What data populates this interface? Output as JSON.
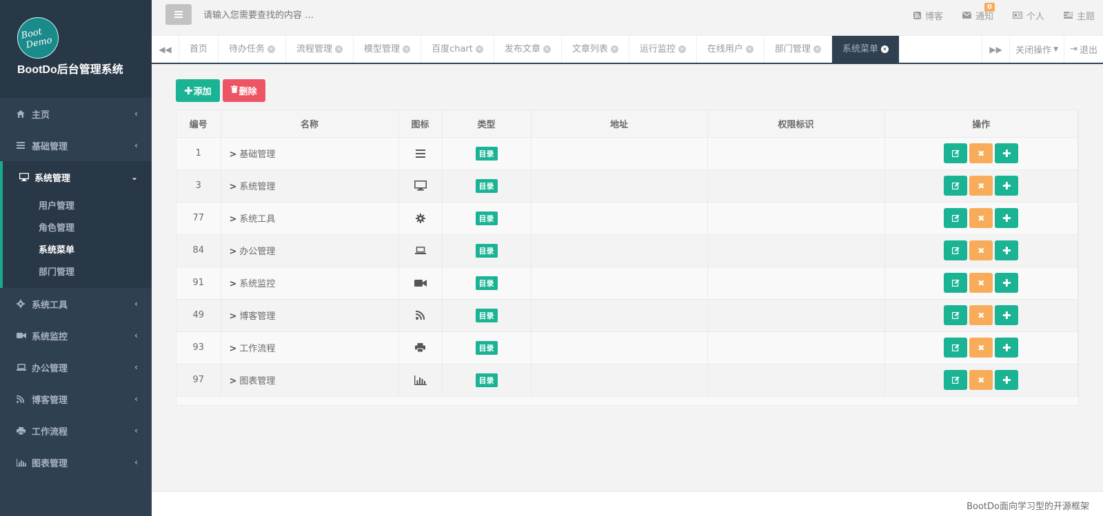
{
  "app": {
    "logo_line1": "Boot",
    "logo_line2": "Demo",
    "name": "BootDo后台管理系统"
  },
  "sidebar": {
    "items": [
      {
        "label": "主页",
        "icon": "home-icon"
      },
      {
        "label": "基础管理",
        "icon": "bars-icon"
      },
      {
        "label": "系统管理",
        "icon": "desktop-icon",
        "expanded": true
      },
      {
        "label": "系统工具",
        "icon": "gear-icon"
      },
      {
        "label": "系统监控",
        "icon": "video-icon"
      },
      {
        "label": "办公管理",
        "icon": "laptop-icon"
      },
      {
        "label": "博客管理",
        "icon": "rss-icon"
      },
      {
        "label": "工作流程",
        "icon": "print-icon"
      },
      {
        "label": "图表管理",
        "icon": "bar-chart-icon"
      }
    ],
    "sub_items": [
      "用户管理",
      "角色管理",
      "系统菜单",
      "部门管理"
    ],
    "active_sub": "系统菜单"
  },
  "topbar": {
    "search_placeholder": "请输入您需要查找的内容 …",
    "links": {
      "blog": "博客",
      "notify": "通知",
      "notify_count": "0",
      "personal": "个人",
      "theme": "主题"
    }
  },
  "tabs": {
    "items": [
      "首页",
      "待办任务",
      "流程管理",
      "模型管理",
      "百度chart",
      "发布文章",
      "文章列表",
      "运行监控",
      "在线用户",
      "部门管理",
      "系统菜单"
    ],
    "active": "系统菜单",
    "close_ops": "关闭操作",
    "logout": "退出"
  },
  "toolbar": {
    "add_label": "添加",
    "delete_label": "删除"
  },
  "table": {
    "headers": [
      "编号",
      "名称",
      "图标",
      "类型",
      "地址",
      "权限标识",
      "操作"
    ],
    "rows": [
      {
        "id": "1",
        "name": "基础管理",
        "icon": "bars-icon",
        "type": "目录",
        "url": "",
        "perms": ""
      },
      {
        "id": "3",
        "name": "系统管理",
        "icon": "desktop-icon",
        "type": "目录",
        "url": "",
        "perms": ""
      },
      {
        "id": "77",
        "name": "系统工具",
        "icon": "gear-icon",
        "type": "目录",
        "url": "",
        "perms": ""
      },
      {
        "id": "84",
        "name": "办公管理",
        "icon": "laptop-icon",
        "type": "目录",
        "url": "",
        "perms": ""
      },
      {
        "id": "91",
        "name": "系统监控",
        "icon": "video-icon",
        "type": "目录",
        "url": "",
        "perms": ""
      },
      {
        "id": "49",
        "name": "博客管理",
        "icon": "rss-icon",
        "type": "目录",
        "url": "",
        "perms": ""
      },
      {
        "id": "93",
        "name": "工作流程",
        "icon": "print-icon",
        "type": "目录",
        "url": "",
        "perms": ""
      },
      {
        "id": "97",
        "name": "图表管理",
        "icon": "bar-chart-icon",
        "type": "目录",
        "url": "",
        "perms": ""
      }
    ]
  },
  "footer": {
    "text": "BootDo面向学习型的开源框架"
  },
  "colors": {
    "sidebar_bg": "#2f4050",
    "primary": "#1ab394",
    "danger": "#ed5565",
    "warning": "#f8ac59"
  }
}
